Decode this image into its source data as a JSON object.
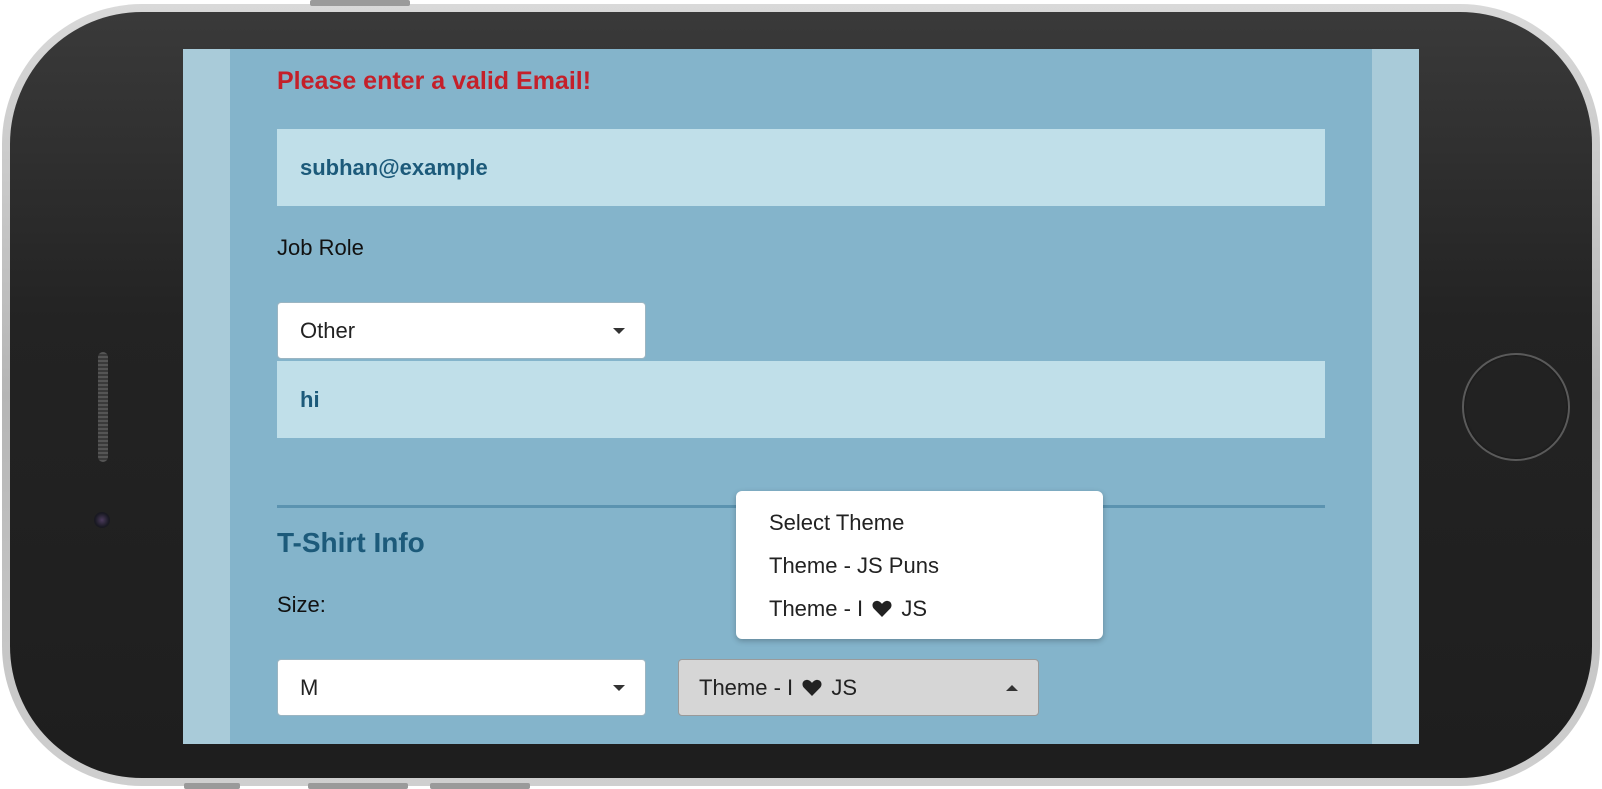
{
  "form": {
    "email_error": "Please enter a valid Email!",
    "email_value": "subhan@example",
    "job_role_label": "Job Role",
    "job_role_selected": "Other",
    "other_role_value": "hi"
  },
  "tshirt": {
    "section_title": "T-Shirt Info",
    "size_label": "Size:",
    "size_selected": "M",
    "design_selected_prefix": "Theme - I ",
    "design_selected_suffix": " JS",
    "design_options": [
      {
        "label": "Select Theme"
      },
      {
        "label": "Theme - JS Puns"
      },
      {
        "label_prefix": "Theme - I ",
        "label_suffix": " JS"
      }
    ]
  },
  "icons": {
    "heart": "heart-icon",
    "caret_down": "caret-down-icon",
    "caret_up": "caret-up-icon"
  },
  "colors": {
    "error": "#c4202a",
    "accent": "#1c5a7a",
    "form_bg": "#84b4cb",
    "input_bg": "#c0dfe9"
  }
}
